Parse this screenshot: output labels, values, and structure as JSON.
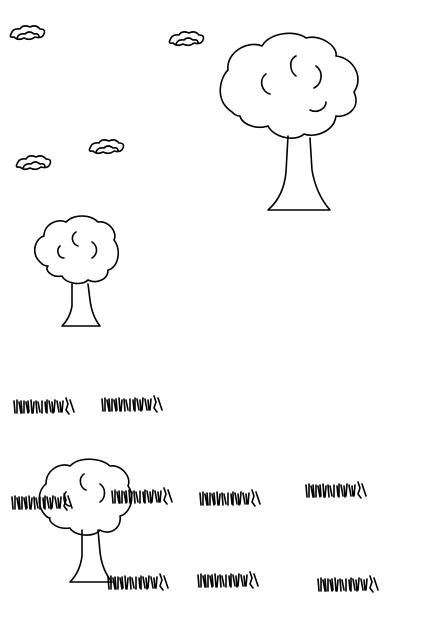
{
  "scene": {
    "background": "#ffffff",
    "stroke_color": "#000000",
    "objects": [
      {
        "kind": "tree",
        "icon": "tree-icon",
        "id": "tree-large"
      },
      {
        "kind": "tree",
        "icon": "tree-icon",
        "id": "tree-medium"
      },
      {
        "kind": "tree",
        "icon": "tree-icon",
        "id": "tree-bottom"
      },
      {
        "kind": "cloud",
        "icon": "cloud-icon",
        "count": 4
      },
      {
        "kind": "grass",
        "icon": "grass-icon",
        "count": 9
      }
    ]
  }
}
